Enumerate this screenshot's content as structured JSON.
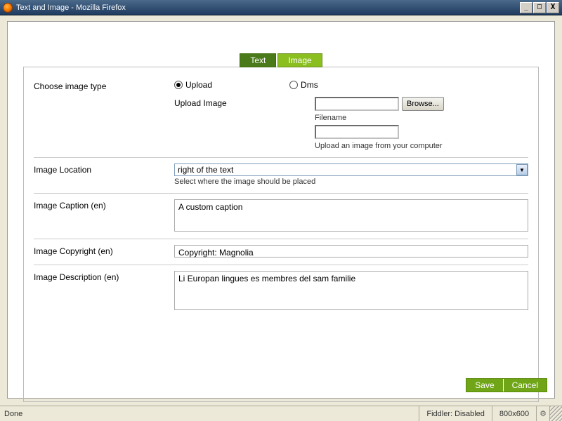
{
  "window": {
    "title": "Text and Image - Mozilla Firefox"
  },
  "tabs": {
    "text": "Text",
    "image": "Image"
  },
  "form": {
    "imageType": {
      "label": "Choose image type",
      "options": {
        "upload": "Upload",
        "dms": "Dms"
      },
      "selected": "upload"
    },
    "uploadImage": {
      "label": "Upload Image",
      "browse": "Browse...",
      "filenameLabel": "Filename",
      "filenameValue": "",
      "hint": "Upload an image from your computer"
    },
    "location": {
      "label": "Image Location",
      "value": "right of the text",
      "hint": "Select where the image should be placed"
    },
    "caption": {
      "label": "Image Caption (en)",
      "value": "A custom caption"
    },
    "copyright": {
      "label": "Image Copyright (en)",
      "value": "Copyright: Magnolia"
    },
    "description": {
      "label": "Image Description (en)",
      "value": "Li Europan lingues es membres del sam familie"
    }
  },
  "actions": {
    "save": "Save",
    "cancel": "Cancel"
  },
  "status": {
    "left": "Done",
    "fiddler": "Fiddler: Disabled",
    "dims": "800x600"
  }
}
